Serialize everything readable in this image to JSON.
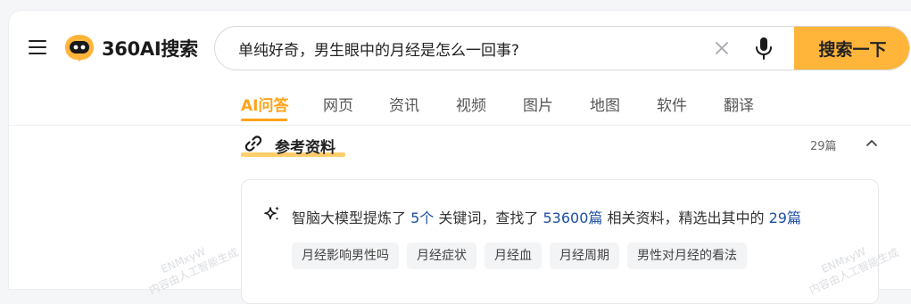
{
  "header": {
    "logo_text": "360AI搜索",
    "search": {
      "value": "单纯好奇，男生眼中的月经是怎么一回事?",
      "placeholder": ""
    },
    "search_button_label": "搜索一下"
  },
  "tabs": [
    {
      "label": "AI问答",
      "active": true
    },
    {
      "label": "网页",
      "active": false
    },
    {
      "label": "资讯",
      "active": false
    },
    {
      "label": "视频",
      "active": false
    },
    {
      "label": "图片",
      "active": false
    },
    {
      "label": "地图",
      "active": false
    },
    {
      "label": "软件",
      "active": false
    },
    {
      "label": "翻译",
      "active": false
    }
  ],
  "references": {
    "title": "参考资料",
    "count_label": "29篇",
    "summary": {
      "part1": "智脑大模型提炼了",
      "keyword_count": "5个",
      "part2": "关键词，查找了",
      "found_count": "53600篇",
      "part3": "相关资料，精选出其中的",
      "selected_count": "29篇"
    },
    "keywords": [
      "月经影响男性吗",
      "月经症状",
      "月经血",
      "月经周期",
      "男性对月经的看法"
    ]
  },
  "watermarks": {
    "line1": "ENMxyW",
    "line2": "内容由人工智能生成"
  },
  "colors": {
    "accent": "#ffa31a",
    "search_button": "#ffb43a",
    "link_highlight": "#1c4fa0"
  },
  "icons": [
    "menu-icon",
    "logo-icon",
    "clear-icon",
    "microphone-icon",
    "link-icon",
    "chevron-up-icon",
    "sparkle-icon"
  ]
}
